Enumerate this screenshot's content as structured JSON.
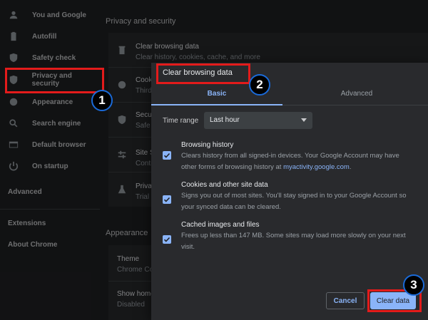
{
  "sidebar": {
    "items": [
      {
        "label": "You and Google",
        "icon": "person-icon"
      },
      {
        "label": "Autofill",
        "icon": "clipboard-icon"
      },
      {
        "label": "Safety check",
        "icon": "shield-check-icon"
      },
      {
        "label": "Privacy and security",
        "icon": "shield-icon"
      },
      {
        "label": "Appearance",
        "icon": "palette-icon"
      },
      {
        "label": "Search engine",
        "icon": "search-icon"
      },
      {
        "label": "Default browser",
        "icon": "browser-icon"
      },
      {
        "label": "On startup",
        "icon": "power-icon"
      }
    ],
    "advanced": "Advanced",
    "extensions": "Extensions",
    "about": "About Chrome"
  },
  "main": {
    "privacy_title": "Privacy and security",
    "rows": [
      {
        "title": "Clear browsing data",
        "sub": "Clear history, cookies, cache, and more"
      },
      {
        "title": "Cook",
        "sub": "Third"
      },
      {
        "title": "Secu",
        "sub": "Safe"
      },
      {
        "title": "Site S",
        "sub": "Contr"
      },
      {
        "title": "Priva",
        "sub": "Trial"
      }
    ],
    "appearance_title": "Appearance",
    "appearance_rows": [
      {
        "title": "Theme",
        "sub": "Chrome Co"
      },
      {
        "title": "Show home",
        "sub": "Disabled"
      }
    ]
  },
  "dialog": {
    "title": "Clear browsing data",
    "tabs": {
      "basic": "Basic",
      "advanced": "Advanced"
    },
    "time_range_label": "Time range",
    "time_range_value": "Last hour",
    "options": [
      {
        "title": "Browsing history",
        "desc_a": "Clears history from all signed-in devices. Your Google Account may have other forms of browsing history at ",
        "link": "myactivity.google.com",
        "desc_b": ".",
        "checked": true
      },
      {
        "title": "Cookies and other site data",
        "desc_a": "Signs you out of most sites. You'll stay signed in to your Google Account so your synced data can be cleared.",
        "checked": true
      },
      {
        "title": "Cached images and files",
        "desc_a": "Frees up less than 147 MB. Some sites may load more slowly on your next visit.",
        "checked": true
      }
    ],
    "cancel": "Cancel",
    "clear": "Clear data"
  },
  "annotations": {
    "step1": "1",
    "step2": "2",
    "step3": "3"
  },
  "colors": {
    "accent": "#8ab4f8",
    "highlight": "#e31b1b",
    "badge_ring": "#1a6ad8"
  }
}
